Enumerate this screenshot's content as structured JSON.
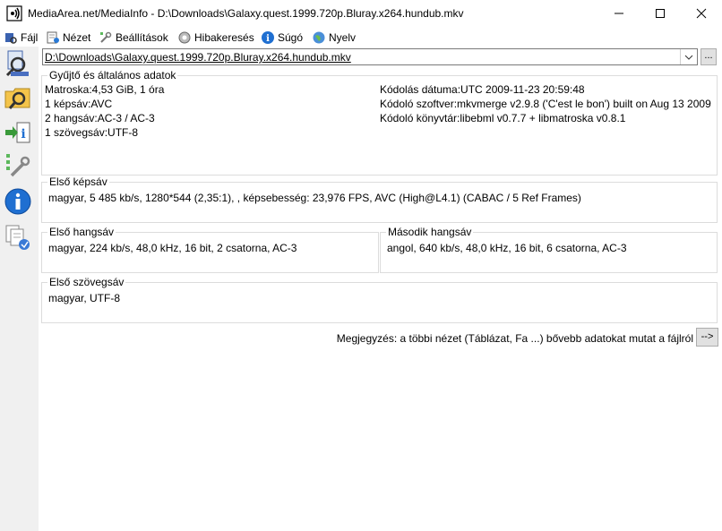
{
  "window": {
    "title": "MediaArea.net/MediaInfo - D:\\Downloads\\Galaxy.quest.1999.720p.Bluray.x264.hundub.mkv",
    "controls": [
      "minimize-icon",
      "maximize-icon",
      "close-icon"
    ]
  },
  "menu": [
    {
      "label": "Fájl",
      "icon": "file-icon"
    },
    {
      "label": "Nézet",
      "icon": "view-icon"
    },
    {
      "label": "Beállítások",
      "icon": "settings-icon"
    },
    {
      "label": "Hibakeresés",
      "icon": "debug-icon"
    },
    {
      "label": "Súgó",
      "icon": "help-icon"
    },
    {
      "label": "Nyelv",
      "icon": "language-icon"
    }
  ],
  "toolbar": [
    "open-file-icon",
    "open-folder-icon",
    "export-icon",
    "preferences-icon",
    "about-icon",
    "other-views-icon"
  ],
  "file_path": "D:\\Downloads\\Galaxy.quest.1999.720p.Bluray.x264.hundub.mkv",
  "browse_label": "...",
  "general": {
    "title": "Gyűjtő és általános adatok",
    "left": [
      "Matroska:4,53 GiB, 1 óra",
      "1 képsáv:AVC",
      "2 hangsáv:AC-3 / AC-3",
      "1 szövegsáv:UTF-8"
    ],
    "right": [
      "Kódolás dátuma:UTC 2009-11-23 20:59:48",
      "Kódoló szoftver:mkvmerge v2.9.8 ('C'est le bon') built on Aug 13 2009",
      "Kódoló könyvtár:libebml v0.7.7 + libmatroska v0.8.1"
    ]
  },
  "video": {
    "title": "Első képsáv",
    "text": "magyar, 5 485 kb/s, 1280*544 (2,35:1), , képsebesség: 23,976 FPS, AVC (High@L4.1) (CABAC / 5 Ref Frames)"
  },
  "audio1": {
    "title": "Első hangsáv",
    "text": "magyar, 224 kb/s, 48,0 kHz, 16 bit, 2 csatorna, AC-3"
  },
  "audio2": {
    "title": "Második hangsáv",
    "text": "angol, 640 kb/s, 48,0 kHz, 16 bit, 6 csatorna, AC-3"
  },
  "text_track": {
    "title": "Első szövegsáv",
    "text": "magyar, UTF-8"
  },
  "note": "Megjegyzés: a többi nézet (Táblázat, Fa ...) bővebb adatokat mutat a fájlról",
  "note_button": "-->"
}
